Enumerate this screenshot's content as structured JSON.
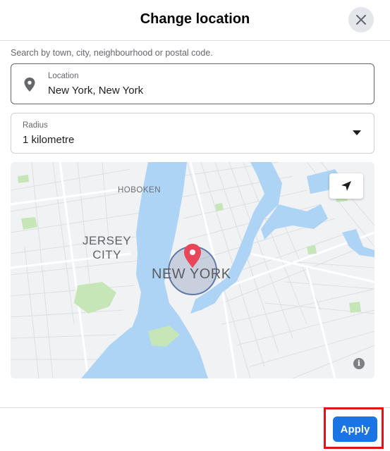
{
  "dialog": {
    "title": "Change location",
    "close_icon": "close-icon"
  },
  "search": {
    "hint": "Search by town, city, neighbourhood or postal code.",
    "location_label": "Location",
    "location_value": "New York, New York",
    "location_icon": "map-pin-icon"
  },
  "radius": {
    "label": "Radius",
    "value": "1 kilometre",
    "icon": "caret-down-icon"
  },
  "map": {
    "labels": {
      "hoboken": "HOBOKEN",
      "jersey_city": "JERSEY\nCITY",
      "new_york": "NEW YORK"
    },
    "locate_icon": "navigation-arrow-icon",
    "info_icon": "info-icon",
    "colors": {
      "water": "#aed4f5",
      "land": "#f1f2f4",
      "park": "#c7e6b8",
      "pin": "#e8475a"
    }
  },
  "footer": {
    "apply_label": "Apply"
  },
  "colors": {
    "accent": "#1b74e4",
    "highlight_frame": "#e4111b"
  }
}
